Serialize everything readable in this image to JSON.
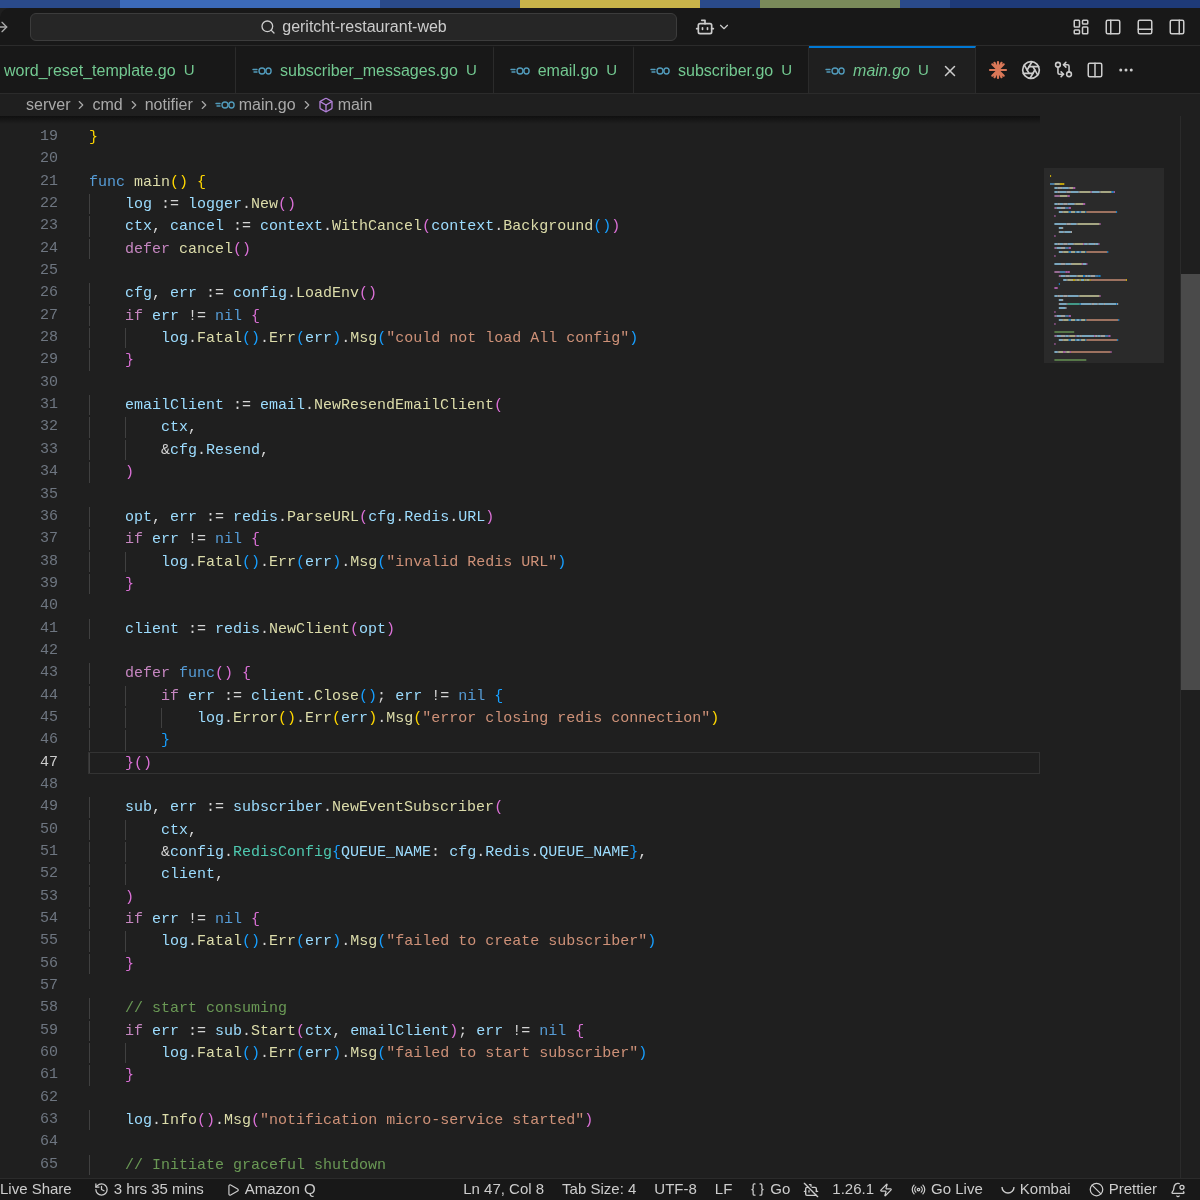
{
  "title_bar": {
    "search": "geritcht-restaurant-web"
  },
  "tabs": [
    {
      "label": "word_reset_template.go",
      "status": "U",
      "selected": false,
      "preview": false,
      "kind": "cut"
    },
    {
      "label": "subscriber_messages.go",
      "status": "U",
      "selected": false,
      "preview": false,
      "kind": "file"
    },
    {
      "label": "email.go",
      "status": "U",
      "selected": false,
      "preview": false,
      "kind": "file"
    },
    {
      "label": "subscriber.go",
      "status": "U",
      "selected": false,
      "preview": false,
      "kind": "file"
    },
    {
      "label": "main.go",
      "status": "U",
      "selected": true,
      "preview": true,
      "kind": "file"
    }
  ],
  "breadcrumb": [
    {
      "kind": "folder",
      "label": "server"
    },
    {
      "kind": "folder",
      "label": "cmd"
    },
    {
      "kind": "folder",
      "label": "notifier"
    },
    {
      "kind": "file",
      "label": "main.go"
    },
    {
      "kind": "symbol",
      "label": "main"
    }
  ],
  "lines": [
    {
      "number": "19",
      "current": false,
      "tokens": [
        {
          "kind": "bracket1",
          "text": "}"
        }
      ]
    },
    {
      "number": "20",
      "current": false
    },
    {
      "number": "21",
      "current": false,
      "tokens": [
        {
          "kind": "keyword",
          "text": "func"
        },
        {
          "kind": "call",
          "text": " main"
        },
        {
          "kind": "bracket1",
          "text": "()"
        },
        {
          "kind": "bracket1",
          "text": " {"
        }
      ]
    },
    {
      "number": "22",
      "current": false,
      "tokens": [
        {
          "kind": "name",
          "text": "\tlog"
        },
        {
          "kind": "text",
          "text": " := "
        },
        {
          "kind": "name",
          "text": "logger"
        },
        {
          "kind": "text",
          "text": "."
        },
        {
          "kind": "call",
          "text": "New"
        },
        {
          "kind": "bracket2",
          "text": "()"
        }
      ]
    },
    {
      "number": "23",
      "current": false,
      "tokens": [
        {
          "kind": "name",
          "text": "\tctx"
        },
        {
          "kind": "text",
          "text": ", "
        },
        {
          "kind": "name",
          "text": "cancel"
        },
        {
          "kind": "text",
          "text": " := "
        },
        {
          "kind": "name",
          "text": "context"
        },
        {
          "kind": "text",
          "text": "."
        },
        {
          "kind": "call",
          "text": "WithCancel"
        },
        {
          "kind": "bracket2",
          "text": "("
        },
        {
          "kind": "name",
          "text": "context"
        },
        {
          "kind": "text",
          "text": "."
        },
        {
          "kind": "call",
          "text": "Background"
        },
        {
          "kind": "bracket3",
          "text": "()"
        },
        {
          "kind": "bracket2",
          "text": ")"
        }
      ]
    },
    {
      "number": "24",
      "current": false,
      "tokens": [
        {
          "kind": "control",
          "text": "\tdefer"
        },
        {
          "kind": "call",
          "text": " cancel"
        },
        {
          "kind": "bracket2",
          "text": "()"
        }
      ]
    },
    {
      "number": "25",
      "current": false
    },
    {
      "number": "26",
      "current": false,
      "tokens": [
        {
          "kind": "name",
          "text": "\tcfg"
        },
        {
          "kind": "text",
          "text": ", "
        },
        {
          "kind": "name",
          "text": "err"
        },
        {
          "kind": "text",
          "text": " := "
        },
        {
          "kind": "name",
          "text": "config"
        },
        {
          "kind": "text",
          "text": "."
        },
        {
          "kind": "call",
          "text": "LoadEnv"
        },
        {
          "kind": "bracket2",
          "text": "()"
        }
      ]
    },
    {
      "number": "27",
      "current": false,
      "tokens": [
        {
          "kind": "control",
          "text": "\tif"
        },
        {
          "kind": "name",
          "text": " err"
        },
        {
          "kind": "text",
          "text": " != "
        },
        {
          "kind": "keyword",
          "text": "nil"
        },
        {
          "kind": "bracket2",
          "text": " {"
        }
      ]
    },
    {
      "number": "28",
      "current": false,
      "tokens": [
        {
          "kind": "name",
          "text": "\t\tlog"
        },
        {
          "kind": "text",
          "text": "."
        },
        {
          "kind": "call",
          "text": "Fatal"
        },
        {
          "kind": "bracket3",
          "text": "()"
        },
        {
          "kind": "text",
          "text": "."
        },
        {
          "kind": "call",
          "text": "Err"
        },
        {
          "kind": "bracket3",
          "text": "("
        },
        {
          "kind": "name",
          "text": "err"
        },
        {
          "kind": "bracket3",
          "text": ")"
        },
        {
          "kind": "text",
          "text": "."
        },
        {
          "kind": "call",
          "text": "Msg"
        },
        {
          "kind": "bracket3",
          "text": "("
        },
        {
          "kind": "string",
          "text": "\"could not load All config\""
        },
        {
          "kind": "bracket3",
          "text": ")"
        }
      ]
    },
    {
      "number": "29",
      "current": false,
      "tokens": [
        {
          "kind": "bracket2",
          "text": "\t}"
        }
      ]
    },
    {
      "number": "30",
      "current": false
    },
    {
      "number": "31",
      "current": false,
      "tokens": [
        {
          "kind": "name",
          "text": "\temailClient"
        },
        {
          "kind": "text",
          "text": " := "
        },
        {
          "kind": "name",
          "text": "email"
        },
        {
          "kind": "text",
          "text": "."
        },
        {
          "kind": "call",
          "text": "NewResendEmailClient"
        },
        {
          "kind": "bracket2",
          "text": "("
        }
      ]
    },
    {
      "number": "32",
      "current": false,
      "tokens": [
        {
          "kind": "name",
          "text": "\t\tctx"
        },
        {
          "kind": "text",
          "text": ","
        }
      ]
    },
    {
      "number": "33",
      "current": false,
      "tokens": [
        {
          "kind": "text",
          "text": "\t\t&"
        },
        {
          "kind": "name",
          "text": "cfg"
        },
        {
          "kind": "text",
          "text": "."
        },
        {
          "kind": "name",
          "text": "Resend"
        },
        {
          "kind": "text",
          "text": ","
        }
      ]
    },
    {
      "number": "34",
      "current": false,
      "tokens": [
        {
          "kind": "bracket2",
          "text": "\t)"
        }
      ]
    },
    {
      "number": "35",
      "current": false
    },
    {
      "number": "36",
      "current": false,
      "tokens": [
        {
          "kind": "name",
          "text": "\topt"
        },
        {
          "kind": "text",
          "text": ", "
        },
        {
          "kind": "name",
          "text": "err"
        },
        {
          "kind": "text",
          "text": " := "
        },
        {
          "kind": "name",
          "text": "redis"
        },
        {
          "kind": "text",
          "text": "."
        },
        {
          "kind": "call",
          "text": "ParseURL"
        },
        {
          "kind": "bracket2",
          "text": "("
        },
        {
          "kind": "name",
          "text": "cfg"
        },
        {
          "kind": "text",
          "text": "."
        },
        {
          "kind": "name",
          "text": "Redis"
        },
        {
          "kind": "text",
          "text": "."
        },
        {
          "kind": "name",
          "text": "URL"
        },
        {
          "kind": "bracket2",
          "text": ")"
        }
      ]
    },
    {
      "number": "37",
      "current": false,
      "tokens": [
        {
          "kind": "control",
          "text": "\tif"
        },
        {
          "kind": "name",
          "text": " err"
        },
        {
          "kind": "text",
          "text": " != "
        },
        {
          "kind": "keyword",
          "text": "nil"
        },
        {
          "kind": "bracket2",
          "text": " {"
        }
      ]
    },
    {
      "number": "38",
      "current": false,
      "tokens": [
        {
          "kind": "name",
          "text": "\t\tlog"
        },
        {
          "kind": "text",
          "text": "."
        },
        {
          "kind": "call",
          "text": "Fatal"
        },
        {
          "kind": "bracket3",
          "text": "()"
        },
        {
          "kind": "text",
          "text": "."
        },
        {
          "kind": "call",
          "text": "Err"
        },
        {
          "kind": "bracket3",
          "text": "("
        },
        {
          "kind": "name",
          "text": "err"
        },
        {
          "kind": "bracket3",
          "text": ")"
        },
        {
          "kind": "text",
          "text": "."
        },
        {
          "kind": "call",
          "text": "Msg"
        },
        {
          "kind": "bracket3",
          "text": "("
        },
        {
          "kind": "string",
          "text": "\"invalid Redis URL\""
        },
        {
          "kind": "bracket3",
          "text": ")"
        }
      ]
    },
    {
      "number": "39",
      "current": false,
      "tokens": [
        {
          "kind": "bracket2",
          "text": "\t}"
        }
      ]
    },
    {
      "number": "40",
      "current": false
    },
    {
      "number": "41",
      "current": false,
      "tokens": [
        {
          "kind": "name",
          "text": "\tclient"
        },
        {
          "kind": "text",
          "text": " := "
        },
        {
          "kind": "name",
          "text": "redis"
        },
        {
          "kind": "text",
          "text": "."
        },
        {
          "kind": "call",
          "text": "NewClient"
        },
        {
          "kind": "bracket2",
          "text": "("
        },
        {
          "kind": "name",
          "text": "opt"
        },
        {
          "kind": "bracket2",
          "text": ")"
        }
      ]
    },
    {
      "number": "42",
      "current": false
    },
    {
      "number": "43",
      "current": false,
      "tokens": [
        {
          "kind": "control",
          "text": "\tdefer"
        },
        {
          "kind": "keyword",
          "text": " func"
        },
        {
          "kind": "bracket2",
          "text": "()"
        },
        {
          "kind": "bracket2",
          "text": " {"
        }
      ]
    },
    {
      "number": "44",
      "current": false,
      "tokens": [
        {
          "kind": "control",
          "text": "\t\tif"
        },
        {
          "kind": "name",
          "text": " err"
        },
        {
          "kind": "text",
          "text": " := "
        },
        {
          "kind": "name",
          "text": "client"
        },
        {
          "kind": "text",
          "text": "."
        },
        {
          "kind": "call",
          "text": "Close"
        },
        {
          "kind": "bracket3",
          "text": "()"
        },
        {
          "kind": "text",
          "text": "; "
        },
        {
          "kind": "name",
          "text": "err"
        },
        {
          "kind": "text",
          "text": " != "
        },
        {
          "kind": "keyword",
          "text": "nil"
        },
        {
          "kind": "bracket3",
          "text": " {"
        }
      ]
    },
    {
      "number": "45",
      "current": false,
      "tokens": [
        {
          "kind": "name",
          "text": "\t\t\tlog"
        },
        {
          "kind": "text",
          "text": "."
        },
        {
          "kind": "call",
          "text": "Error"
        },
        {
          "kind": "bracket1",
          "text": "()"
        },
        {
          "kind": "text",
          "text": "."
        },
        {
          "kind": "call",
          "text": "Err"
        },
        {
          "kind": "bracket1",
          "text": "("
        },
        {
          "kind": "name",
          "text": "err"
        },
        {
          "kind": "bracket1",
          "text": ")"
        },
        {
          "kind": "text",
          "text": "."
        },
        {
          "kind": "call",
          "text": "Msg"
        },
        {
          "kind": "bracket1",
          "text": "("
        },
        {
          "kind": "string",
          "text": "\"error closing redis connection\""
        },
        {
          "kind": "bracket1",
          "text": ")"
        }
      ]
    },
    {
      "number": "46",
      "current": false,
      "tokens": [
        {
          "kind": "bracket3",
          "text": "\t\t}"
        }
      ]
    },
    {
      "number": "47",
      "current": true,
      "tokens": [
        {
          "kind": "bracket2",
          "text": "\t}()"
        }
      ]
    },
    {
      "number": "48",
      "current": false
    },
    {
      "number": "49",
      "current": false,
      "tokens": [
        {
          "kind": "name",
          "text": "\tsub"
        },
        {
          "kind": "text",
          "text": ", "
        },
        {
          "kind": "name",
          "text": "err"
        },
        {
          "kind": "text",
          "text": " := "
        },
        {
          "kind": "name",
          "text": "subscriber"
        },
        {
          "kind": "text",
          "text": "."
        },
        {
          "kind": "call",
          "text": "NewEventSubscriber"
        },
        {
          "kind": "bracket2",
          "text": "("
        }
      ]
    },
    {
      "number": "50",
      "current": false,
      "tokens": [
        {
          "kind": "name",
          "text": "\t\tctx"
        },
        {
          "kind": "text",
          "text": ","
        }
      ]
    },
    {
      "number": "51",
      "current": false,
      "tokens": [
        {
          "kind": "text",
          "text": "\t\t&"
        },
        {
          "kind": "name",
          "text": "config"
        },
        {
          "kind": "text",
          "text": "."
        },
        {
          "kind": "type",
          "text": "RedisConfig"
        },
        {
          "kind": "bracket3",
          "text": "{"
        },
        {
          "kind": "name",
          "text": "QUEUE_NAME"
        },
        {
          "kind": "text",
          "text": ": "
        },
        {
          "kind": "name",
          "text": "cfg"
        },
        {
          "kind": "text",
          "text": "."
        },
        {
          "kind": "name",
          "text": "Redis"
        },
        {
          "kind": "text",
          "text": "."
        },
        {
          "kind": "name",
          "text": "QUEUE_NAME"
        },
        {
          "kind": "bracket3",
          "text": "}"
        },
        {
          "kind": "text",
          "text": ","
        }
      ]
    },
    {
      "number": "52",
      "current": false,
      "tokens": [
        {
          "kind": "name",
          "text": "\t\tclient"
        },
        {
          "kind": "text",
          "text": ","
        }
      ]
    },
    {
      "number": "53",
      "current": false,
      "tokens": [
        {
          "kind": "bracket2",
          "text": "\t)"
        }
      ]
    },
    {
      "number": "54",
      "current": false,
      "tokens": [
        {
          "kind": "control",
          "text": "\tif"
        },
        {
          "kind": "name",
          "text": " err"
        },
        {
          "kind": "text",
          "text": " != "
        },
        {
          "kind": "keyword",
          "text": "nil"
        },
        {
          "kind": "bracket2",
          "text": " {"
        }
      ]
    },
    {
      "number": "55",
      "current": false,
      "tokens": [
        {
          "kind": "name",
          "text": "\t\tlog"
        },
        {
          "kind": "text",
          "text": "."
        },
        {
          "kind": "call",
          "text": "Fatal"
        },
        {
          "kind": "bracket3",
          "text": "()"
        },
        {
          "kind": "text",
          "text": "."
        },
        {
          "kind": "call",
          "text": "Err"
        },
        {
          "kind": "bracket3",
          "text": "("
        },
        {
          "kind": "name",
          "text": "err"
        },
        {
          "kind": "bracket3",
          "text": ")"
        },
        {
          "kind": "text",
          "text": "."
        },
        {
          "kind": "call",
          "text": "Msg"
        },
        {
          "kind": "bracket3",
          "text": "("
        },
        {
          "kind": "string",
          "text": "\"failed to create subscriber\""
        },
        {
          "kind": "bracket3",
          "text": ")"
        }
      ]
    },
    {
      "number": "56",
      "current": false,
      "tokens": [
        {
          "kind": "bracket2",
          "text": "\t}"
        }
      ]
    },
    {
      "number": "57",
      "current": false
    },
    {
      "number": "58",
      "current": false,
      "tokens": [
        {
          "kind": "comment",
          "text": "\t// start consuming"
        }
      ]
    },
    {
      "number": "59",
      "current": false,
      "tokens": [
        {
          "kind": "control",
          "text": "\tif"
        },
        {
          "kind": "name",
          "text": " err"
        },
        {
          "kind": "text",
          "text": " := "
        },
        {
          "kind": "name",
          "text": "sub"
        },
        {
          "kind": "text",
          "text": "."
        },
        {
          "kind": "call",
          "text": "Start"
        },
        {
          "kind": "bracket2",
          "text": "("
        },
        {
          "kind": "name",
          "text": "ctx"
        },
        {
          "kind": "text",
          "text": ", "
        },
        {
          "kind": "name",
          "text": "emailClient"
        },
        {
          "kind": "bracket2",
          "text": ")"
        },
        {
          "kind": "text",
          "text": "; "
        },
        {
          "kind": "name",
          "text": "err"
        },
        {
          "kind": "text",
          "text": " != "
        },
        {
          "kind": "keyword",
          "text": "nil"
        },
        {
          "kind": "bracket2",
          "text": " {"
        }
      ]
    },
    {
      "number": "60",
      "current": false,
      "tokens": [
        {
          "kind": "name",
          "text": "\t\tlog"
        },
        {
          "kind": "text",
          "text": "."
        },
        {
          "kind": "call",
          "text": "Fatal"
        },
        {
          "kind": "bracket3",
          "text": "()"
        },
        {
          "kind": "text",
          "text": "."
        },
        {
          "kind": "call",
          "text": "Err"
        },
        {
          "kind": "bracket3",
          "text": "("
        },
        {
          "kind": "name",
          "text": "err"
        },
        {
          "kind": "bracket3",
          "text": ")"
        },
        {
          "kind": "text",
          "text": "."
        },
        {
          "kind": "call",
          "text": "Msg"
        },
        {
          "kind": "bracket3",
          "text": "("
        },
        {
          "kind": "string",
          "text": "\"failed to start subscriber\""
        },
        {
          "kind": "bracket3",
          "text": ")"
        }
      ]
    },
    {
      "number": "61",
      "current": false,
      "tokens": [
        {
          "kind": "bracket2",
          "text": "\t}"
        }
      ]
    },
    {
      "number": "62",
      "current": false
    },
    {
      "number": "63",
      "current": false,
      "tokens": [
        {
          "kind": "name",
          "text": "\tlog"
        },
        {
          "kind": "text",
          "text": "."
        },
        {
          "kind": "call",
          "text": "Info"
        },
        {
          "kind": "bracket2",
          "text": "()"
        },
        {
          "kind": "text",
          "text": "."
        },
        {
          "kind": "call",
          "text": "Msg"
        },
        {
          "kind": "bracket2",
          "text": "("
        },
        {
          "kind": "string",
          "text": "\"notification micro-service started\""
        },
        {
          "kind": "bracket2",
          "text": ")"
        }
      ]
    },
    {
      "number": "64",
      "current": false
    },
    {
      "number": "65",
      "current": false,
      "tokens": [
        {
          "kind": "comment",
          "text": "\t// Initiate graceful shutdown"
        }
      ]
    }
  ],
  "status_bar": {
    "left": [
      {
        "kind": "live-share",
        "text": "Live Share"
      },
      {
        "kind": "timer",
        "text": "3 hrs 35 mins"
      },
      {
        "kind": "amazon-q",
        "text": "Amazon Q"
      }
    ],
    "right": [
      {
        "kind": "plain",
        "text": "Ln 47, Col 8"
      },
      {
        "kind": "plain",
        "text": "Tab Size: 4"
      },
      {
        "kind": "plain",
        "text": "UTF-8"
      },
      {
        "kind": "plain",
        "text": "LF"
      },
      {
        "kind": "language",
        "text": "Go"
      },
      {
        "kind": "copilot-off"
      },
      {
        "kind": "version",
        "text": "1.26.1"
      },
      {
        "kind": "go-live",
        "text": "Go Live"
      },
      {
        "kind": "kombai",
        "text": "Kombai"
      },
      {
        "kind": "prettier",
        "text": "Prettier"
      },
      {
        "kind": "bell"
      }
    ]
  }
}
